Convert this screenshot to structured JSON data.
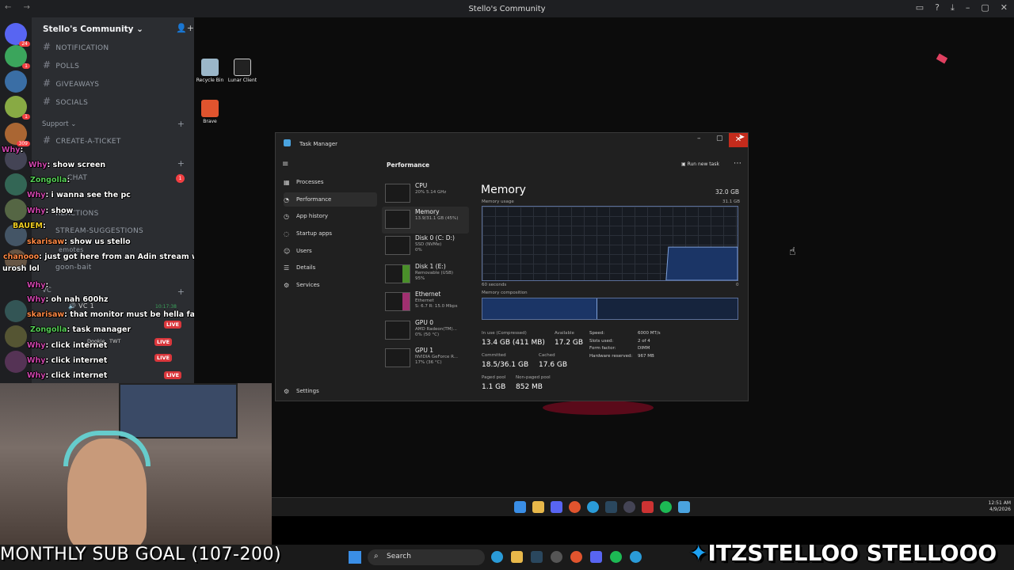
{
  "window": {
    "title": "Stello's Community"
  },
  "discord": {
    "server_name": "Stello's Community",
    "servers": [
      {
        "badge": "24"
      },
      {
        "badge": "1"
      },
      {
        "badge": "1"
      },
      {
        "badge": "1"
      },
      {
        "badge": "309"
      }
    ],
    "channels": [
      "NOTIFICATION",
      "POLLS",
      "GIVEAWAYS",
      "SOCIALS"
    ],
    "support_category": "Support",
    "support_channels": [
      "CREATE-A-TICKET",
      "CHAT",
      "REACTIONS",
      "STREAM-SUGGESTIONS"
    ],
    "other_channels": [
      "emotes",
      "goon-bait"
    ],
    "vc_category": "VC",
    "vc_channel": "VC 1",
    "vc_time": "10:17:38",
    "vc_users": [
      "Dookie",
      "TWT"
    ],
    "live_label": "LIVE",
    "unread_badge": "1"
  },
  "chat": [
    {
      "user": "Why",
      "msg": ":"
    },
    {
      "user": "Why",
      "msg": ": show screen"
    },
    {
      "user": "Zongolla",
      "msg": ":"
    },
    {
      "user": "Why",
      "msg": ": i wanna see the pc"
    },
    {
      "user": "Why",
      "msg": ": show"
    },
    {
      "user": "BAUEM",
      "msg": ":"
    },
    {
      "user": "skarisaw",
      "msg": ": show us stello"
    },
    {
      "user": "chanooo",
      "msg": ": just got here from an Adin stream with sweater and you in a discord with"
    },
    {
      "user": "",
      "msg": "urosh lol"
    },
    {
      "user": "Why",
      "msg": ":"
    },
    {
      "user": "Why",
      "msg": ": oh nah 600hz"
    },
    {
      "user": "skarisaw",
      "msg": ": that monitor must be hella fast"
    },
    {
      "user": "Zongolla",
      "msg": ": task manager"
    },
    {
      "user": "Why",
      "msg": ": click internet"
    },
    {
      "user": "Why",
      "msg": ": click internet"
    },
    {
      "user": "Why",
      "msg": ": click internet"
    }
  ],
  "desktop_icons": [
    {
      "label": "Recycle Bin",
      "icon": "recycle-bin-icon"
    },
    {
      "label": "Lunar Client",
      "icon": "lunar-client-icon"
    },
    {
      "label": "Brave",
      "icon": "brave-icon"
    }
  ],
  "task_manager": {
    "title": "Task Manager",
    "nav": [
      "Processes",
      "Performance",
      "App history",
      "Startup apps",
      "Users",
      "Details",
      "Services"
    ],
    "settings": "Settings",
    "pane_title": "Performance",
    "run_new_task": "Run new task",
    "resources": [
      {
        "name": "CPU",
        "sub": "20% 5.14 GHz"
      },
      {
        "name": "Memory",
        "sub": "13.9/31.1 GB (45%)"
      },
      {
        "name": "Disk 0 (C: D:)",
        "sub": "SSD (NVMe)\n0%"
      },
      {
        "name": "Disk 1 (E:)",
        "sub": "Removable (USB)\n95%"
      },
      {
        "name": "Ethernet",
        "sub": "Ethernet\nS: 6.7 R: 15.0 Mbps"
      },
      {
        "name": "GPU 0",
        "sub": "AMD Radeon(TM)...\n0% (50 °C)"
      },
      {
        "name": "GPU 1",
        "sub": "NVIDIA GeForce R...\n17% (36 °C)"
      }
    ],
    "memory": {
      "title": "Memory",
      "total": "32.0 GB",
      "usage_label": "Memory usage",
      "usage_max": "31.1 GB",
      "time_label": "60 seconds",
      "zero": "0",
      "composition_label": "Memory composition",
      "in_use_label": "In use (Compressed)",
      "in_use": "13.4 GB (411 MB)",
      "available_label": "Available",
      "available": "17.2 GB",
      "committed_label": "Committed",
      "committed": "18.5/36.1 GB",
      "cached_label": "Cached",
      "cached": "17.6 GB",
      "paged_label": "Paged pool",
      "paged": "1.1 GB",
      "nonpaged_label": "Non-paged pool",
      "nonpaged": "852 MB",
      "speed_label": "Speed:",
      "speed": "6000 MT/s",
      "slots_label": "Slots used:",
      "slots": "2 of 4",
      "form_label": "Form factor:",
      "form": "DIMM",
      "hwres_label": "Hardware reserved:",
      "hwres": "967 MB",
      "usage_fraction": 0.45
    }
  },
  "taskbar": {
    "time": "12:51 AM",
    "date": "4/9/2026",
    "search": "Search"
  },
  "overlay": {
    "goal": "MONTHLY SUB GOAL (107-200)",
    "social": "ITZSTELLOO  STELLOOO"
  }
}
